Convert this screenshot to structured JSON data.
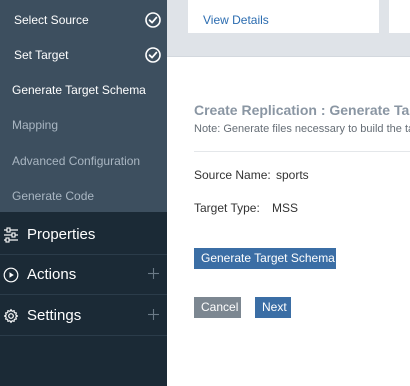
{
  "sidebar": {
    "steps": [
      {
        "label": "Select Source",
        "state": "done"
      },
      {
        "label": "Set Target",
        "state": "done"
      },
      {
        "label": "Generate Target Schema",
        "state": "current"
      },
      {
        "label": "Mapping",
        "state": "pending"
      },
      {
        "label": "Advanced Configuration",
        "state": "pending"
      },
      {
        "label": "Generate Code",
        "state": "pending"
      }
    ],
    "nav": [
      {
        "label": "Properties",
        "icon": "sliders-icon",
        "expandable": false
      },
      {
        "label": "Actions",
        "icon": "play-circle-icon",
        "expandable": true
      },
      {
        "label": "Settings",
        "icon": "gear-icon",
        "expandable": true
      }
    ]
  },
  "top_card": {
    "link": "View Details"
  },
  "page": {
    "title": "Create Replication : Generate Target Schema",
    "note": "Note: Generate files necessary to build the target schema"
  },
  "fields": {
    "source_name_label": "Source Name:",
    "source_name_value": "sports",
    "target_type_label": "Target Type:",
    "target_type_value": "MSS"
  },
  "buttons": {
    "generate": "Generate Target Schema",
    "cancel": "Cancel",
    "next": "Next"
  },
  "colors": {
    "sidebar_dark": "#1b2a36",
    "sidebar_steps": "#3d4f5f",
    "primary": "#3b6ea5",
    "secondary": "#7c8791",
    "link": "#2b6cb0"
  }
}
